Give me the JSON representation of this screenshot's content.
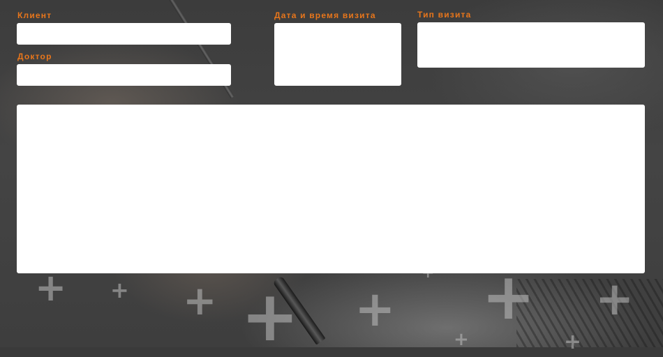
{
  "form": {
    "client": {
      "label": "Клиент",
      "value": ""
    },
    "doctor": {
      "label": "Доктор",
      "value": ""
    },
    "datetime": {
      "label": "Дата и время визита",
      "value": ""
    },
    "visit_type": {
      "label": "Тип визита",
      "value": ""
    },
    "notes": {
      "value": ""
    }
  },
  "colors": {
    "label_accent": "#e8761b",
    "field_background": "#ffffff",
    "backdrop": "#3a3a3a"
  },
  "decorations": {
    "plus_glyph": "+"
  }
}
